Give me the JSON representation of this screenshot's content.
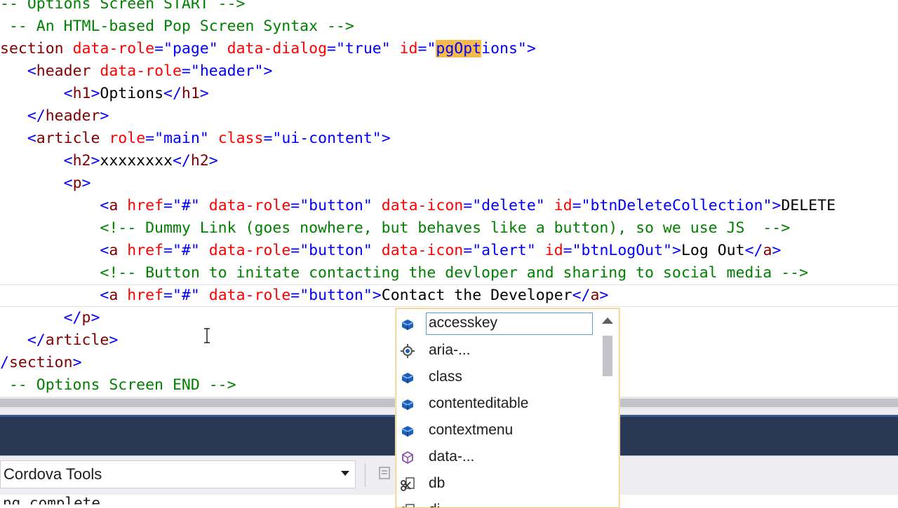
{
  "editor": {
    "lines": [
      {
        "parts": [
          {
            "t": "-- Options Screen START -->",
            "c": "com"
          }
        ]
      },
      {
        "parts": [
          {
            "t": " -- An HTML-based Pop Screen Syntax -->",
            "c": "com"
          }
        ]
      },
      {
        "parts": [
          {
            "t": "section",
            "c": "tag"
          },
          {
            "t": " ",
            "c": "txt"
          },
          {
            "t": "data-role",
            "c": "attr"
          },
          {
            "t": "=",
            "c": "br"
          },
          {
            "t": "\"page\"",
            "c": "val"
          },
          {
            "t": " ",
            "c": "txt"
          },
          {
            "t": "data-dialog",
            "c": "attr"
          },
          {
            "t": "=",
            "c": "br"
          },
          {
            "t": "\"true\"",
            "c": "val"
          },
          {
            "t": " ",
            "c": "txt"
          },
          {
            "t": "id",
            "c": "attr"
          },
          {
            "t": "=",
            "c": "br"
          },
          {
            "t": "\"",
            "c": "val"
          },
          {
            "t": "pgOpt",
            "c": "val",
            "hl": true
          },
          {
            "t": "ions\"",
            "c": "val"
          },
          {
            "t": ">",
            "c": "br"
          }
        ]
      },
      {
        "parts": [
          {
            "t": "   ",
            "c": "txt"
          },
          {
            "t": "<",
            "c": "br"
          },
          {
            "t": "header",
            "c": "tag"
          },
          {
            "t": " ",
            "c": "txt"
          },
          {
            "t": "data-role",
            "c": "attr"
          },
          {
            "t": "=",
            "c": "br"
          },
          {
            "t": "\"header\"",
            "c": "val"
          },
          {
            "t": ">",
            "c": "br"
          }
        ]
      },
      {
        "parts": [
          {
            "t": "       ",
            "c": "txt"
          },
          {
            "t": "<",
            "c": "br"
          },
          {
            "t": "h1",
            "c": "tag"
          },
          {
            "t": ">",
            "c": "br"
          },
          {
            "t": "Options",
            "c": "txt"
          },
          {
            "t": "</",
            "c": "br"
          },
          {
            "t": "h1",
            "c": "tag"
          },
          {
            "t": ">",
            "c": "br"
          }
        ]
      },
      {
        "parts": [
          {
            "t": "   ",
            "c": "txt"
          },
          {
            "t": "</",
            "c": "br"
          },
          {
            "t": "header",
            "c": "tag"
          },
          {
            "t": ">",
            "c": "br"
          }
        ]
      },
      {
        "parts": [
          {
            "t": "   ",
            "c": "txt"
          },
          {
            "t": "<",
            "c": "br"
          },
          {
            "t": "article",
            "c": "tag"
          },
          {
            "t": " ",
            "c": "txt"
          },
          {
            "t": "role",
            "c": "attr"
          },
          {
            "t": "=",
            "c": "br"
          },
          {
            "t": "\"main\"",
            "c": "val"
          },
          {
            "t": " ",
            "c": "txt"
          },
          {
            "t": "class",
            "c": "attr"
          },
          {
            "t": "=",
            "c": "br"
          },
          {
            "t": "\"ui-content\"",
            "c": "val"
          },
          {
            "t": ">",
            "c": "br"
          }
        ]
      },
      {
        "parts": [
          {
            "t": "       ",
            "c": "txt"
          },
          {
            "t": "<",
            "c": "br"
          },
          {
            "t": "h2",
            "c": "tag"
          },
          {
            "t": ">",
            "c": "br"
          },
          {
            "t": "xxxxxxxx",
            "c": "txt"
          },
          {
            "t": "</",
            "c": "br"
          },
          {
            "t": "h2",
            "c": "tag"
          },
          {
            "t": ">",
            "c": "br"
          }
        ]
      },
      {
        "parts": [
          {
            "t": "       ",
            "c": "txt"
          },
          {
            "t": "<",
            "c": "br"
          },
          {
            "t": "p",
            "c": "tag"
          },
          {
            "t": ">",
            "c": "br"
          }
        ]
      },
      {
        "parts": [
          {
            "t": "           ",
            "c": "txt"
          },
          {
            "t": "<",
            "c": "br"
          },
          {
            "t": "a",
            "c": "tag"
          },
          {
            "t": " ",
            "c": "txt"
          },
          {
            "t": "href",
            "c": "attr"
          },
          {
            "t": "=",
            "c": "br"
          },
          {
            "t": "\"#\"",
            "c": "val"
          },
          {
            "t": " ",
            "c": "txt"
          },
          {
            "t": "data-role",
            "c": "attr"
          },
          {
            "t": "=",
            "c": "br"
          },
          {
            "t": "\"button\"",
            "c": "val"
          },
          {
            "t": " ",
            "c": "txt"
          },
          {
            "t": "data-icon",
            "c": "attr"
          },
          {
            "t": "=",
            "c": "br"
          },
          {
            "t": "\"delete\"",
            "c": "val"
          },
          {
            "t": " ",
            "c": "txt"
          },
          {
            "t": "id",
            "c": "attr"
          },
          {
            "t": "=",
            "c": "br"
          },
          {
            "t": "\"btnDeleteCollection\"",
            "c": "val"
          },
          {
            "t": ">",
            "c": "br"
          },
          {
            "t": "DELETE",
            "c": "txt"
          }
        ]
      },
      {
        "parts": [
          {
            "t": "           ",
            "c": "txt"
          },
          {
            "t": "<!-- Dummy Link (goes nowhere, but behaves like a button), so we use JS  -->",
            "c": "com"
          }
        ]
      },
      {
        "parts": [
          {
            "t": "           ",
            "c": "txt"
          },
          {
            "t": "<",
            "c": "br"
          },
          {
            "t": "a",
            "c": "tag"
          },
          {
            "t": " ",
            "c": "txt"
          },
          {
            "t": "href",
            "c": "attr"
          },
          {
            "t": "=",
            "c": "br"
          },
          {
            "t": "\"#\"",
            "c": "val"
          },
          {
            "t": " ",
            "c": "txt"
          },
          {
            "t": "data-role",
            "c": "attr"
          },
          {
            "t": "=",
            "c": "br"
          },
          {
            "t": "\"button\"",
            "c": "val"
          },
          {
            "t": " ",
            "c": "txt"
          },
          {
            "t": "data-icon",
            "c": "attr"
          },
          {
            "t": "=",
            "c": "br"
          },
          {
            "t": "\"alert\"",
            "c": "val"
          },
          {
            "t": " ",
            "c": "txt"
          },
          {
            "t": "id",
            "c": "attr"
          },
          {
            "t": "=",
            "c": "br"
          },
          {
            "t": "\"btnLogOut\"",
            "c": "val"
          },
          {
            "t": ">",
            "c": "br"
          },
          {
            "t": "Log Out",
            "c": "txt"
          },
          {
            "t": "</",
            "c": "br"
          },
          {
            "t": "a",
            "c": "tag"
          },
          {
            "t": ">",
            "c": "br"
          }
        ]
      },
      {
        "parts": [
          {
            "t": "           ",
            "c": "txt"
          },
          {
            "t": "<!-- Button to initate contacting the devloper and sharing to social media -->",
            "c": "com"
          }
        ]
      },
      {
        "parts": [
          {
            "t": "           ",
            "c": "txt"
          },
          {
            "t": "<",
            "c": "br"
          },
          {
            "t": "a",
            "c": "tag"
          },
          {
            "t": " ",
            "c": "txt"
          },
          {
            "t": "href",
            "c": "attr"
          },
          {
            "t": "=",
            "c": "br"
          },
          {
            "t": "\"#\"",
            "c": "val"
          },
          {
            "t": " ",
            "c": "txt"
          },
          {
            "t": "data-role",
            "c": "attr"
          },
          {
            "t": "=",
            "c": "br"
          },
          {
            "t": "\"button\"",
            "c": "val"
          },
          {
            "t": ">",
            "c": "br"
          },
          {
            "t": "Contact the Developer",
            "c": "txt"
          },
          {
            "t": "</",
            "c": "br"
          },
          {
            "t": "a",
            "c": "tag"
          },
          {
            "t": ">",
            "c": "br"
          }
        ],
        "current": true
      },
      {
        "parts": [
          {
            "t": "       ",
            "c": "txt"
          },
          {
            "t": "</",
            "c": "br"
          },
          {
            "t": "p",
            "c": "tag"
          },
          {
            "t": ">",
            "c": "br"
          }
        ]
      },
      {
        "parts": [
          {
            "t": "   ",
            "c": "txt"
          },
          {
            "t": "</",
            "c": "br"
          },
          {
            "t": "article",
            "c": "tag"
          },
          {
            "t": ">",
            "c": "br"
          }
        ]
      },
      {
        "parts": [
          {
            "t": "/",
            "c": "br"
          },
          {
            "t": "section",
            "c": "tag"
          },
          {
            "t": ">",
            "c": "br"
          }
        ]
      },
      {
        "parts": [
          {
            "t": " -- Options Screen END -->",
            "c": "com"
          }
        ]
      }
    ]
  },
  "completion": {
    "items": [
      {
        "label": "accesskey",
        "icon": "attribute-icon",
        "selected": true
      },
      {
        "label": "aria-...",
        "icon": "aria-attribute-icon"
      },
      {
        "label": "class",
        "icon": "attribute-icon"
      },
      {
        "label": "contenteditable",
        "icon": "attribute-icon"
      },
      {
        "label": "contextmenu",
        "icon": "attribute-icon"
      },
      {
        "label": "data-...",
        "icon": "data-attribute-icon"
      },
      {
        "label": "db",
        "icon": "snippet-icon"
      },
      {
        "label": "di",
        "icon": "snippet-icon"
      }
    ]
  },
  "output": {
    "source_label": "Cordova Tools",
    "text": "ng complete"
  },
  "colors": {
    "comment": "#008000",
    "tag": "#800000",
    "bracket": "#0000ff",
    "attribute": "#ff0000",
    "value": "#0000ff",
    "highlight": "#f6b94b",
    "panel_title": "#293955",
    "popup_border": "#f3c97a"
  }
}
